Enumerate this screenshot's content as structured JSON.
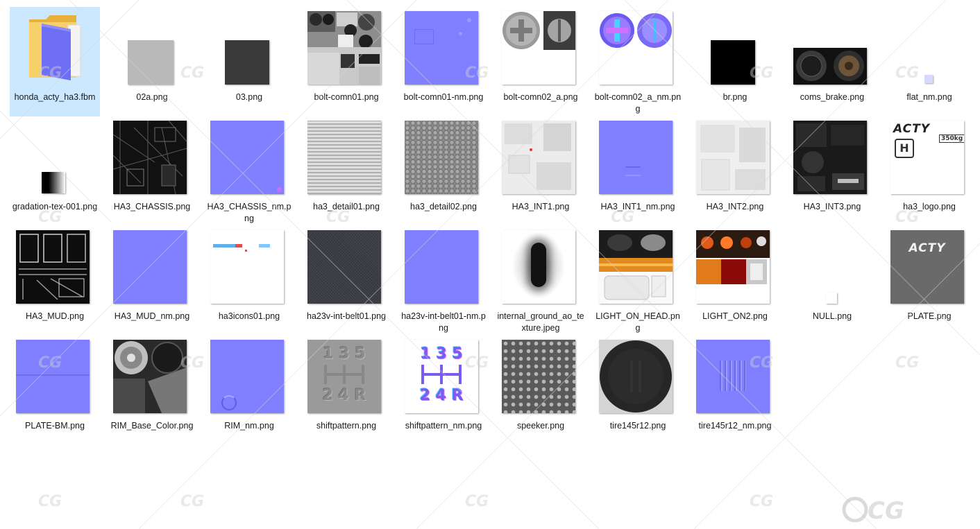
{
  "view": "large-icons",
  "files": [
    {
      "name": "honda_acty_ha3.fbm",
      "type": "folder",
      "selected": true
    },
    {
      "name": "02a.png",
      "type": "image",
      "icon": "gray-swatch"
    },
    {
      "name": "03.png",
      "type": "image",
      "icon": "dark-gray-swatch"
    },
    {
      "name": "bolt-comn01.png",
      "type": "image",
      "icon": "bolt-atlas"
    },
    {
      "name": "bolt-comn01-nm.png",
      "type": "image",
      "icon": "normal-map"
    },
    {
      "name": "bolt-comn02_a.png",
      "type": "image",
      "icon": "screw-heads"
    },
    {
      "name": "bolt-comn02_a_nm.png",
      "type": "image",
      "icon": "screw-normal"
    },
    {
      "name": "br.png",
      "type": "image",
      "icon": "black-swatch"
    },
    {
      "name": "coms_brake.png",
      "type": "image",
      "icon": "brake-discs"
    },
    {
      "name": "flat_nm.png",
      "type": "image",
      "icon": "tiny-normal"
    },
    {
      "name": "gradation-tex-001.png",
      "type": "image",
      "icon": "gradient-strip"
    },
    {
      "name": "HA3_CHASSIS.png",
      "type": "image",
      "icon": "chassis-atlas"
    },
    {
      "name": "HA3_CHASSIS_nm.png",
      "type": "image",
      "icon": "normal-map"
    },
    {
      "name": "ha3_detail01.png",
      "type": "image",
      "icon": "detail-noise"
    },
    {
      "name": "ha3_detail02.png",
      "type": "image",
      "icon": "leather-grain"
    },
    {
      "name": "HA3_INT1.png",
      "type": "image",
      "icon": "interior-atlas-light"
    },
    {
      "name": "HA3_INT1_nm.png",
      "type": "image",
      "icon": "normal-map"
    },
    {
      "name": "HA3_INT2.png",
      "type": "image",
      "icon": "interior-atlas-light"
    },
    {
      "name": "HA3_INT3.png",
      "type": "image",
      "icon": "interior-atlas-dark"
    },
    {
      "name": "ha3_logo.png",
      "type": "image",
      "icon": "logo-sheet",
      "logo_text": "ACTY",
      "logo_sub": "350kg"
    },
    {
      "name": "HA3_MUD.png",
      "type": "image",
      "icon": "mud-atlas"
    },
    {
      "name": "HA3_MUD_nm.png",
      "type": "image",
      "icon": "normal-map"
    },
    {
      "name": "ha3icons01.png",
      "type": "image",
      "icon": "icon-sheet"
    },
    {
      "name": "ha23v-int-belt01.png",
      "type": "image",
      "icon": "belt-fabric"
    },
    {
      "name": "ha23v-int-belt01-nm.png",
      "type": "image",
      "icon": "normal-map"
    },
    {
      "name": "internal_ground_ao_texture.jpeg",
      "type": "image",
      "icon": "ao-shadow"
    },
    {
      "name": "LIGHT_ON_HEAD.png",
      "type": "image",
      "icon": "headlight-atlas"
    },
    {
      "name": "LIGHT_ON2.png",
      "type": "image",
      "icon": "taillight-atlas"
    },
    {
      "name": "NULL.png",
      "type": "image",
      "icon": "white-swatch"
    },
    {
      "name": "PLATE.png",
      "type": "image",
      "icon": "plate",
      "logo_text": "ACTY"
    },
    {
      "name": "PLATE-BM.png",
      "type": "image",
      "icon": "normal-map"
    },
    {
      "name": "RIM_Base_Color.png",
      "type": "image",
      "icon": "rim-atlas"
    },
    {
      "name": "RIM_nm.png",
      "type": "image",
      "icon": "normal-map"
    },
    {
      "name": "shiftpattern.png",
      "type": "image",
      "icon": "shift-pattern",
      "gear_top": "1 3 5",
      "gear_bottom": "2 4 R"
    },
    {
      "name": "shiftpattern_nm.png",
      "type": "image",
      "icon": "shift-pattern-normal",
      "gear_top": "1 3 5",
      "gear_bottom": "2 4 R"
    },
    {
      "name": "speeker.png",
      "type": "image",
      "icon": "speaker-grille"
    },
    {
      "name": "tire145r12.png",
      "type": "image",
      "icon": "tire"
    },
    {
      "name": "tire145r12_nm.png",
      "type": "image",
      "icon": "tire-normal"
    }
  ],
  "colors": {
    "normal_map": "#7f7fff",
    "selection": "#cce8ff",
    "folder": "#f5c84c"
  }
}
